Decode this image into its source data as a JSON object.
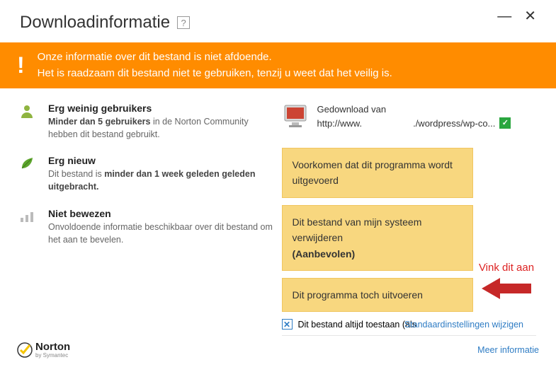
{
  "titlebar": {
    "title": "Downloadinformatie",
    "help": "?"
  },
  "banner": {
    "line1": "Onze informatie over dit bestand is niet afdoende.",
    "line2": "Het is raadzaam dit bestand niet te gebruiken, tenzij u weet dat het veilig is."
  },
  "insights": [
    {
      "icon": "user-icon",
      "heading": "Erg weinig gebruikers",
      "body_prefix": "",
      "body_bold": "Minder dan 5 gebruikers",
      "body_suffix": " in de Norton Community hebben dit bestand gebruikt."
    },
    {
      "icon": "leaf-icon",
      "heading": "Erg nieuw",
      "body_prefix": "Dit bestand is ",
      "body_bold": "minder dan 1 week geleden geleden uitgebracht.",
      "body_suffix": ""
    },
    {
      "icon": "bars-icon",
      "heading": "Niet bewezen",
      "body_prefix": "Onvoldoende informatie beschikbaar over dit bestand om het aan te bevelen.",
      "body_bold": "",
      "body_suffix": ""
    }
  ],
  "download": {
    "label": "Gedownload van",
    "url_prefix": "http://www.",
    "url_suffix": "./wordpress/wp-co...",
    "verified": "✓"
  },
  "options": [
    {
      "text": "Voorkomen dat dit programma wordt uitgevoerd",
      "recommended": ""
    },
    {
      "text": "Dit bestand van mijn systeem verwijderen",
      "recommended": "(Aanbevolen)"
    },
    {
      "text": "Dit programma toch uitvoeren",
      "recommended": ""
    }
  ],
  "annotation": {
    "label": "Vink dit aan"
  },
  "checkbox": {
    "label": "Dit bestand altijd toestaan (als",
    "checked": "✕"
  },
  "links": {
    "defaults": "Standaardinstellingen wijzigen",
    "more": "Meer informatie"
  },
  "footer": {
    "brand": "Norton",
    "by": "by Symantec"
  }
}
